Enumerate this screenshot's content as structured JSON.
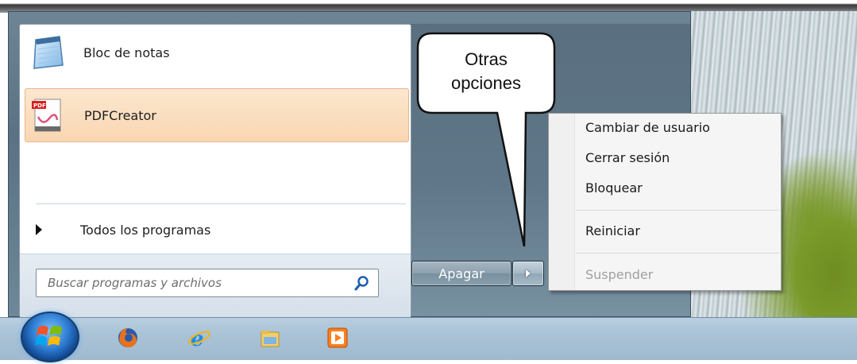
{
  "start_menu": {
    "programs": [
      {
        "label": "Bloc de notas",
        "icon": "notepad-icon"
      },
      {
        "label": "PDFCreator",
        "icon": "pdfcreator-icon"
      }
    ],
    "all_programs_label": "Todos los programas",
    "search": {
      "placeholder": "Buscar programas y archivos",
      "icon": "search-icon"
    },
    "shutdown": {
      "label": "Apagar",
      "arrow_icon": "play-arrow-icon"
    }
  },
  "callout": {
    "line1": "Otras",
    "line2": "opciones"
  },
  "context_menu": {
    "items": [
      {
        "label": "Cambiar de usuario",
        "enabled": true
      },
      {
        "label": "Cerrar sesión",
        "enabled": true
      },
      {
        "label": "Bloquear",
        "enabled": true
      },
      {
        "label": "Reiniciar",
        "enabled": true
      },
      {
        "label": "Suspender",
        "enabled": false
      }
    ]
  },
  "taskbar": {
    "icons": [
      "start-orb-icon",
      "firefox-icon",
      "internet-explorer-icon",
      "file-explorer-icon",
      "media-player-icon"
    ]
  },
  "colors": {
    "highlight": "#f9d6b2",
    "start_menu_frame": "#5a7283",
    "taskbar": "#a9c2d6"
  }
}
